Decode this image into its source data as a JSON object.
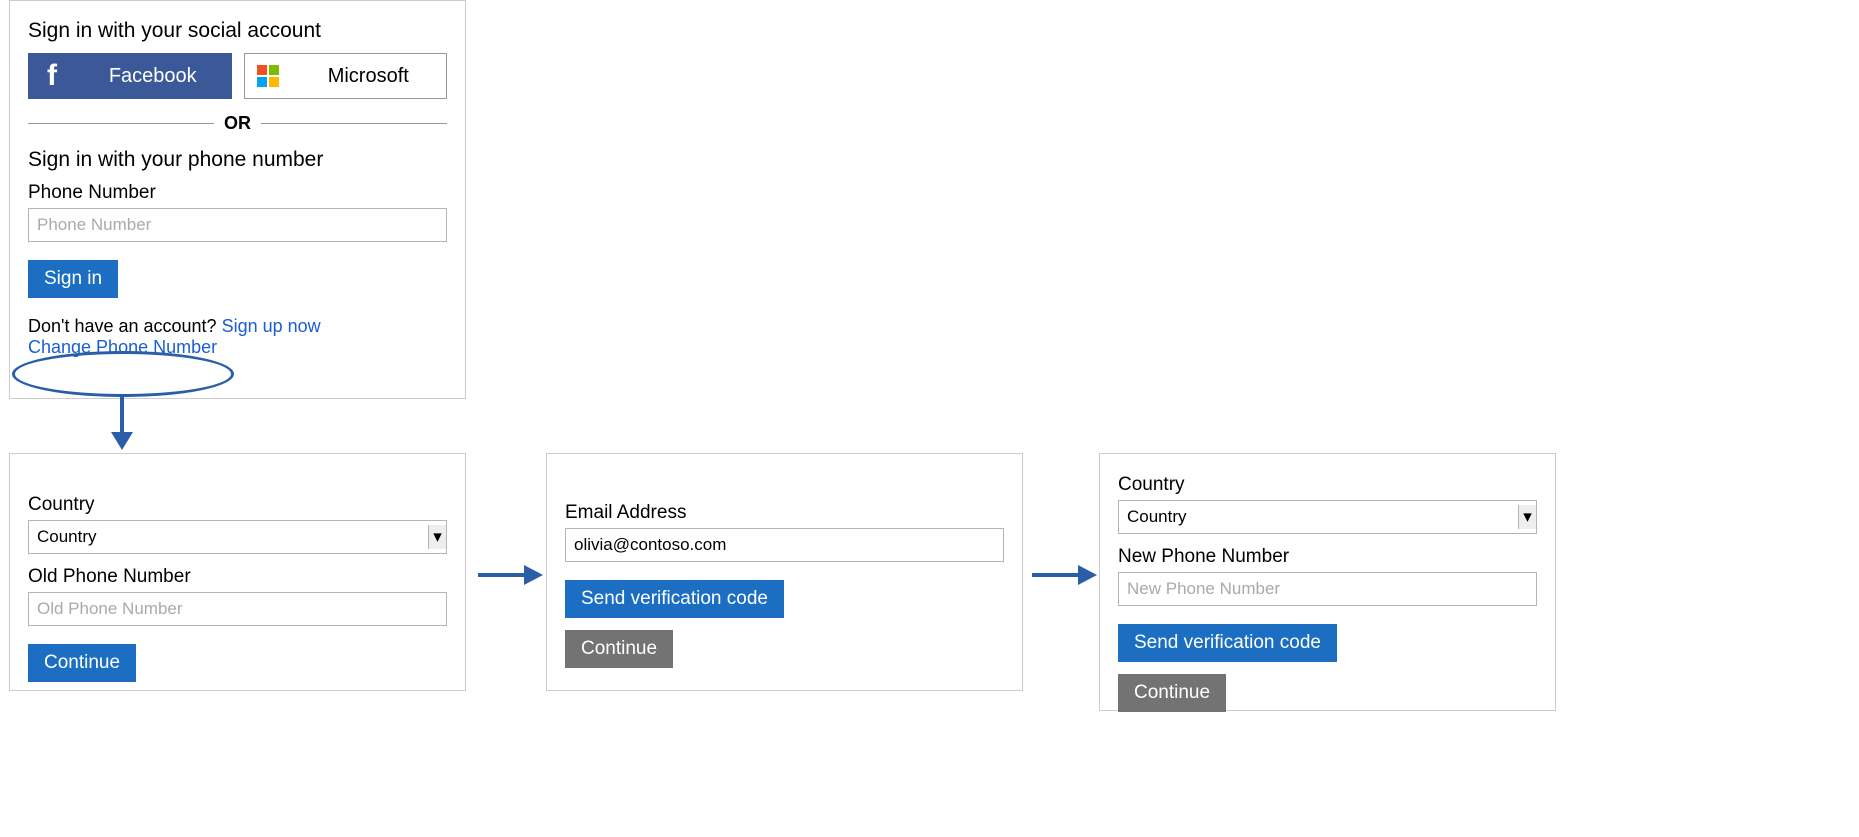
{
  "panel1": {
    "social_heading": "Sign in with your social account",
    "facebook_label": "Facebook",
    "microsoft_label": "Microsoft",
    "or_text": "OR",
    "phone_heading": "Sign in with your phone number",
    "phone_label": "Phone Number",
    "phone_placeholder": "Phone Number",
    "signin_button": "Sign in",
    "no_account_text": "Don't have an account? ",
    "signup_link": "Sign up now",
    "change_phone_link": "Change Phone Number"
  },
  "panel2": {
    "country_label": "Country",
    "country_value": "Country",
    "old_phone_label": "Old Phone Number",
    "old_phone_placeholder": "Old Phone Number",
    "continue_button": "Continue"
  },
  "panel3": {
    "email_label": "Email Address",
    "email_value": "olivia@contoso.com",
    "send_code_button": "Send verification code",
    "continue_button": "Continue"
  },
  "panel4": {
    "country_label": "Country",
    "country_value": "Country",
    "new_phone_label": "New Phone Number",
    "new_phone_placeholder": "New Phone Number",
    "send_code_button": "Send verification code",
    "continue_button": "Continue"
  }
}
